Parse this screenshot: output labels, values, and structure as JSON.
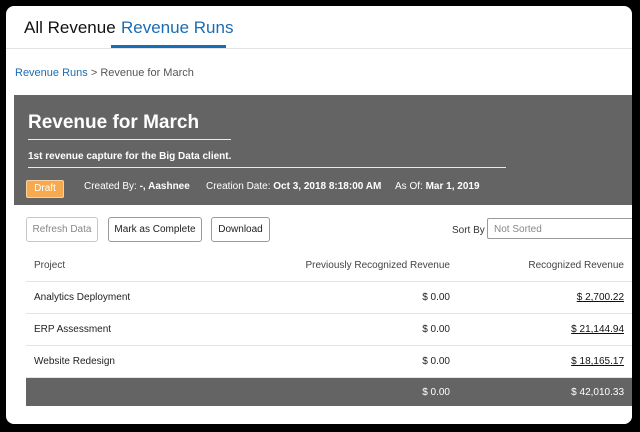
{
  "tabs": [
    {
      "label": "All Revenue",
      "active": false
    },
    {
      "label": "Revenue Runs",
      "active": true
    }
  ],
  "breadcrumb": {
    "parent": "Revenue Runs",
    "separator": " > ",
    "current": "Revenue for March"
  },
  "run": {
    "title": "Revenue for March",
    "description": "1st revenue capture for the Big Data client.",
    "status": "Draft",
    "created_by_label": "Created By:",
    "created_by_value": "-, Aashnee",
    "creation_date_label": "Creation Date:",
    "creation_date_value": "Oct 3, 2018 8:18:00 AM",
    "as_of_label": "As Of:",
    "as_of_value": "Mar 1, 2019"
  },
  "toolbar": {
    "refresh_label": "Refresh Data",
    "complete_label": "Mark as Complete",
    "download_label": "Download",
    "sort_label": "Sort By",
    "sort_value": "Not Sorted"
  },
  "table": {
    "headers": [
      "Project",
      "Previously Recognized Revenue",
      "Recognized Revenue"
    ],
    "rows": [
      {
        "project": "Analytics Deployment",
        "previous": "$ 0.00",
        "recognized": "$ 2,700.22"
      },
      {
        "project": "ERP Assessment",
        "previous": "$ 0.00",
        "recognized": "$ 21,144.94"
      },
      {
        "project": "Website Redesign",
        "previous": "$ 0.00",
        "recognized": "$ 18,165.17"
      }
    ],
    "totals": {
      "previous": "$ 0.00",
      "recognized": "$ 42,010.33"
    }
  },
  "colors": {
    "accent": "#1a6db4",
    "header_bg": "#646464",
    "draft_badge": "#f6a94f"
  }
}
